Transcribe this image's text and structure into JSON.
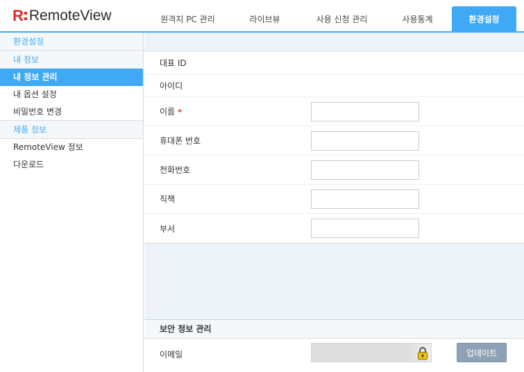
{
  "app": {
    "logo_letter": "R",
    "logo_text": "RemoteView"
  },
  "tabs": [
    {
      "label": "원격지 PC 관리",
      "active": false
    },
    {
      "label": "라이브뷰",
      "active": false
    },
    {
      "label": "사용 신청 관리",
      "active": false
    },
    {
      "label": "사용통계",
      "active": false
    },
    {
      "label": "환경설정",
      "active": true
    }
  ],
  "sidebar": {
    "header": "환경설정",
    "group1": "내 정보",
    "items1": [
      "내 정보 관리",
      "내 옵션 설정",
      "비밀번호 변경"
    ],
    "group2": "제품 정보",
    "items2": [
      "RemoteView 정보",
      "다운로드"
    ]
  },
  "form": {
    "rows": [
      {
        "label": "대표 ID",
        "value": ""
      },
      {
        "label": "아이디",
        "value": ""
      }
    ],
    "name_label": "이름",
    "required_mark": "*",
    "fields": [
      {
        "label": "휴대폰 번호",
        "value": ""
      },
      {
        "label": "전화번호",
        "value": ""
      },
      {
        "label": "직책",
        "value": ""
      },
      {
        "label": "부서",
        "value": ""
      }
    ],
    "name_value": ""
  },
  "security": {
    "title": "보안 정보 관리",
    "email_label": "이메일",
    "email_value": "",
    "update_label": "업데이트"
  },
  "colors": {
    "accent": "#3fa9f5",
    "brand_red": "#e0262d",
    "button_gray": "#8da2b4"
  }
}
